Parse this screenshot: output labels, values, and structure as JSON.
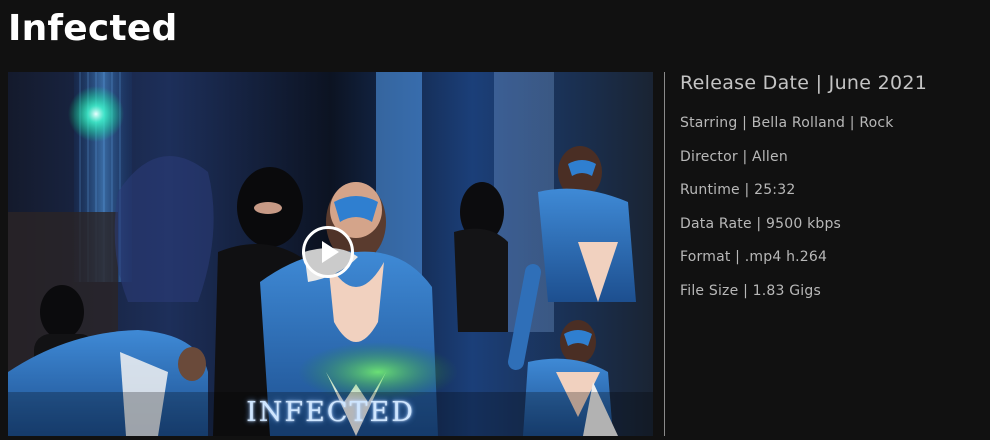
{
  "page": {
    "title": "Infected"
  },
  "video": {
    "poster_title": "INFECTED",
    "play_icon": "play-circle-icon"
  },
  "details": {
    "release_date": "Release Date | June 2021",
    "starring": "Starring | Bella Rolland | Rock",
    "director": "Director | Allen",
    "runtime": "Runtime | 25:32",
    "data_rate": "Data Rate | 9500 kbps",
    "format": "Format | .mp4 h.264",
    "file_size": "File Size | 1.83 Gigs"
  },
  "colors": {
    "background": "#111111",
    "title_text": "#ffffff",
    "details_text": "#bcbcbc",
    "divider": "#8a8a8a",
    "costume_blue": "#2f6fb8"
  }
}
